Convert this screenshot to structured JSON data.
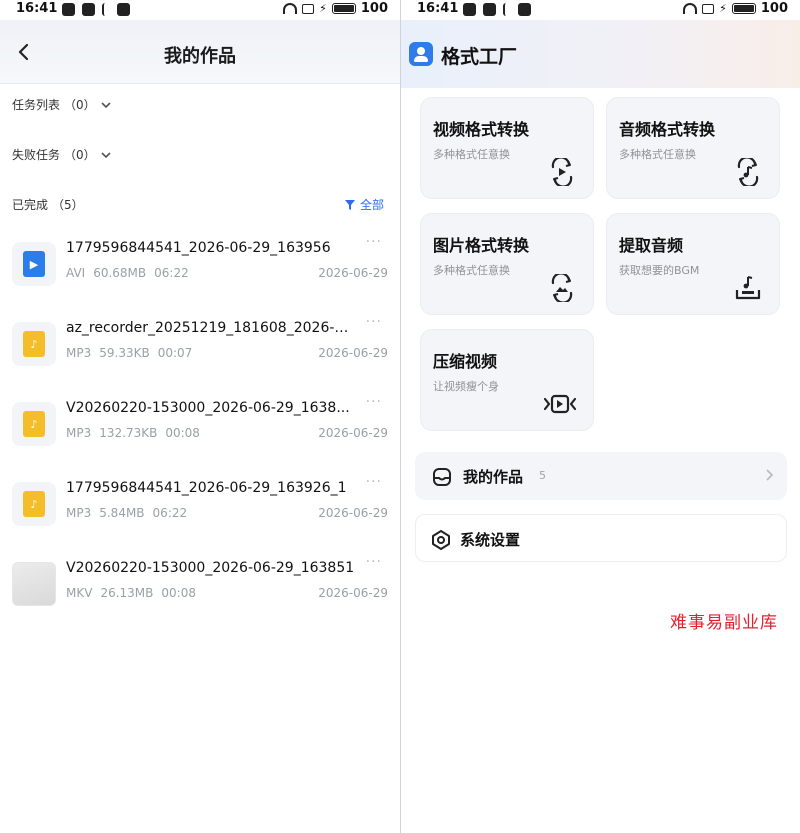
{
  "status_bar": {
    "time": "16:41",
    "battery": "100"
  },
  "left": {
    "title": "我的作品",
    "sections": [
      {
        "label": "任务列表",
        "count": "（0）"
      },
      {
        "label": "失败任务",
        "count": "（0）"
      }
    ],
    "completed": {
      "label": "已完成",
      "count": "（5）",
      "filter_label": "全部"
    },
    "more_glyph": "···",
    "files": [
      {
        "name": "1779596844541_2026-06-29_163956",
        "format": "AVI",
        "size": "60.68MB",
        "duration": "06:22",
        "date": "2026-06-29",
        "icon": "video-file-icon"
      },
      {
        "name": "az_recorder_20251219_181608_2026-0...",
        "format": "MP3",
        "size": "59.33KB",
        "duration": "00:07",
        "date": "2026-06-29",
        "icon": "music-file-icon"
      },
      {
        "name": "V20260220-153000_2026-06-29_1638...",
        "format": "MP3",
        "size": "132.73KB",
        "duration": "00:08",
        "date": "2026-06-29",
        "icon": "music-file-icon"
      },
      {
        "name": "1779596844541_2026-06-29_163926_1",
        "format": "MP3",
        "size": "5.84MB",
        "duration": "06:22",
        "date": "2026-06-29",
        "icon": "music-file-icon"
      },
      {
        "name": "V20260220-153000_2026-06-29_163851",
        "format": "MKV",
        "size": "26.13MB",
        "duration": "00:08",
        "date": "2026-06-29",
        "icon": "video-thumbnail"
      }
    ]
  },
  "right": {
    "app_title": "格式工厂",
    "cards": [
      {
        "title": "视频格式转换",
        "subtitle": "多种格式任意换",
        "icon": "video-convert-icon"
      },
      {
        "title": "音频格式转换",
        "subtitle": "多种格式任意换",
        "icon": "audio-convert-icon"
      },
      {
        "title": "图片格式转换",
        "subtitle": "多种格式任意换",
        "icon": "image-convert-icon"
      },
      {
        "title": "提取音频",
        "subtitle": "获取想要的BGM",
        "icon": "extract-audio-icon"
      },
      {
        "title": "压缩视频",
        "subtitle": "让视频瘦个身",
        "icon": "compress-video-icon"
      }
    ],
    "my_works": {
      "label": "我的作品",
      "count": "5"
    },
    "settings": {
      "label": "系统设置"
    }
  },
  "watermark": "难事易副业库",
  "colors": {
    "accent": "#2d6cf0",
    "video_file": "#2b7de9",
    "music_file": "#f3be2a",
    "watermark": "#e5202d"
  }
}
